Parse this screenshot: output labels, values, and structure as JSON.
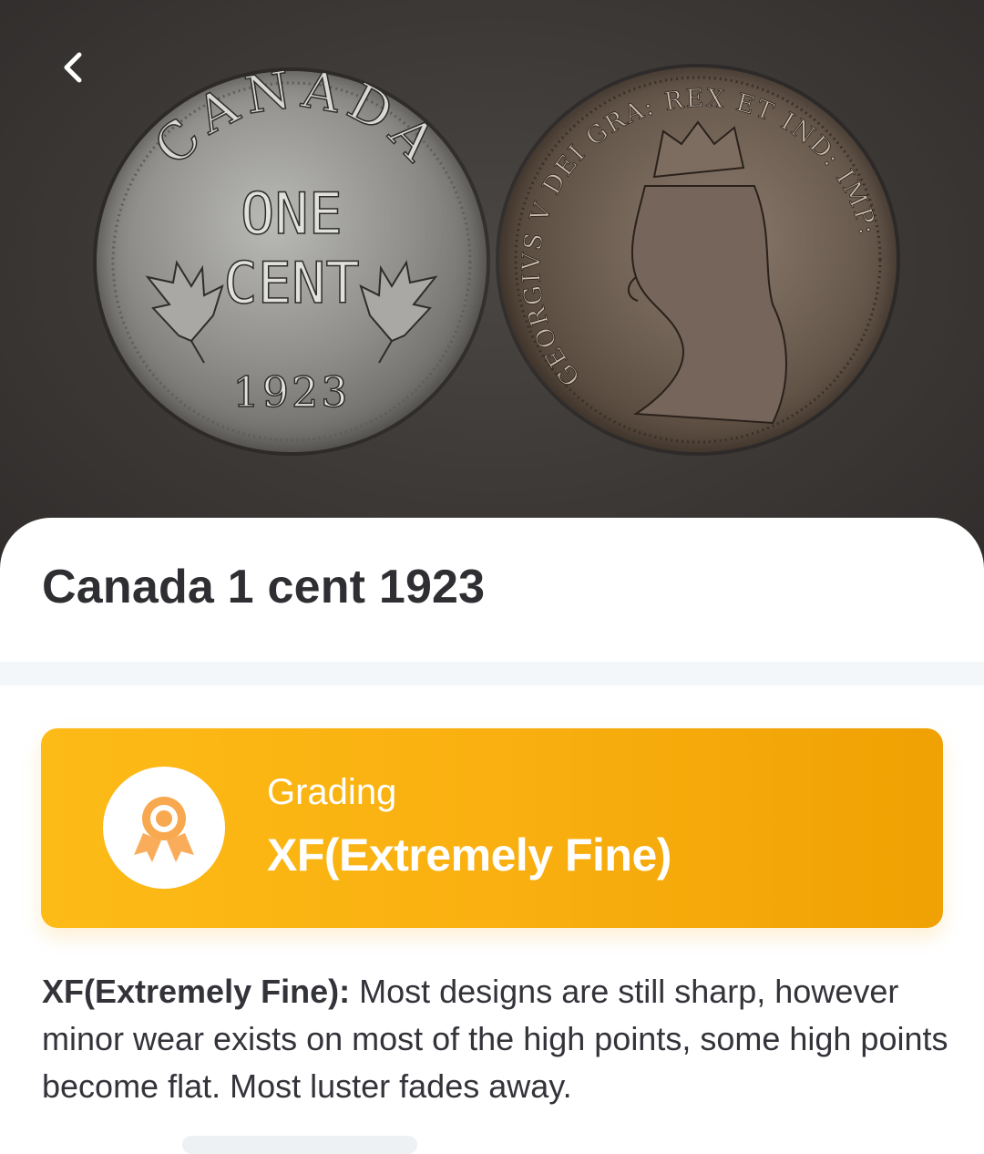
{
  "nav": {
    "back_icon": "chevron-left-icon"
  },
  "hero": {
    "reverse": {
      "country": "CANADA",
      "line1": "ONE",
      "line2": "CENT",
      "year": "1923"
    },
    "obverse": {
      "legend": "GEORGIVS V DEI GRA: REX ET IND: IMP:"
    }
  },
  "coin": {
    "title": "Canada 1 cent 1923"
  },
  "grading": {
    "label": "Grading",
    "value": "XF(Extremely Fine)",
    "icon": "award-ribbon-icon",
    "gradient_start": "#fdbb17",
    "gradient_end": "#f0a103"
  },
  "description": {
    "term": "XF(Extremely Fine):",
    "text": " Most designs are still sharp, however minor wear exists on most of the high points, some high points become flat. Most luster fades away."
  }
}
